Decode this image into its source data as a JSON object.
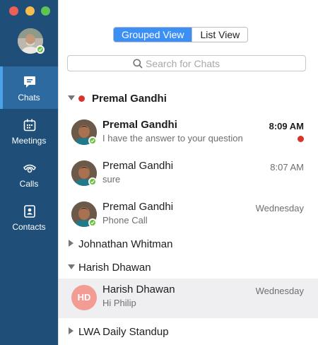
{
  "window": {
    "controls": [
      "close",
      "minimize",
      "zoom"
    ]
  },
  "sidebar": {
    "items": [
      {
        "label": "Chats",
        "icon": "chat-bubble-icon",
        "active": true
      },
      {
        "label": "Meetings",
        "icon": "calendar-icon",
        "active": false
      },
      {
        "label": "Calls",
        "icon": "phone-icon",
        "active": false
      },
      {
        "label": "Contacts",
        "icon": "contact-card-icon",
        "active": false
      }
    ]
  },
  "view_toggle": {
    "options": [
      "Grouped View",
      "List View"
    ],
    "selected": "Grouped View"
  },
  "search": {
    "placeholder": "Search for Chats",
    "value": ""
  },
  "groups": [
    {
      "name": "Premal Gandhi",
      "expanded": true,
      "unread": true,
      "chats": [
        {
          "name": "Premal Gandhi",
          "preview": "I have the answer to your question",
          "time": "8:09 AM",
          "unread": true
        },
        {
          "name": "Premal Gandhi",
          "preview": "sure",
          "time": "8:07 AM",
          "unread": false
        },
        {
          "name": "Premal Gandhi",
          "preview": "Phone Call",
          "time": "Wednesday",
          "unread": false
        }
      ]
    },
    {
      "name": "Johnathan Whitman",
      "expanded": false
    },
    {
      "name": "Harish Dhawan",
      "expanded": true,
      "chats": [
        {
          "name": "Harish Dhawan",
          "preview": "Hi Philip",
          "time": "Wednesday",
          "initials": "HD",
          "selected": true
        }
      ]
    },
    {
      "name": "LWA Daily Standup",
      "expanded": false
    }
  ],
  "colors": {
    "sidebar": "#1f4f78",
    "accent": "#3c8ff5",
    "online": "#6cbf3d",
    "unread": "#d8342b",
    "initials_avatar": "#f39c94"
  }
}
